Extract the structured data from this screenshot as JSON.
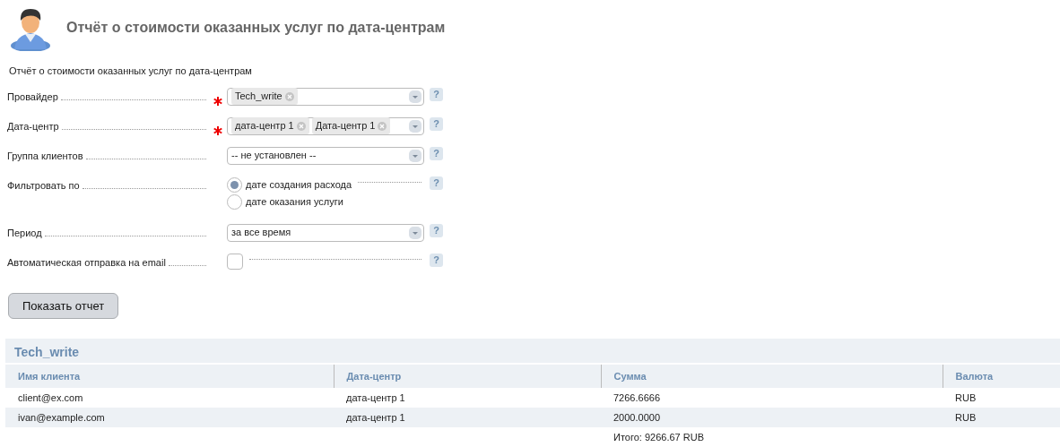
{
  "page_title": "Отчёт о стоимости оказанных услуг по дата-центрам",
  "form_title": "Отчёт о стоимости оказанных услуг по дата-центрам",
  "fields": [
    {
      "kind": "tags",
      "label": "Провайдер",
      "required": true,
      "tags": [
        "Tech_write"
      ],
      "help": "?"
    },
    {
      "kind": "tags",
      "label": "Дата-центр",
      "required": true,
      "tags": [
        "дата-центр 1",
        "Дата-центр 1"
      ],
      "help": "?"
    },
    {
      "kind": "select",
      "label": "Группа клиентов",
      "required": false,
      "value": "-- не установлен --",
      "help": "?"
    },
    {
      "kind": "radio",
      "label": "Фильтровать по",
      "required": false,
      "options": [
        {
          "label": "дате создания расхода",
          "selected": true
        },
        {
          "label": "дате оказания услуги",
          "selected": false
        }
      ],
      "help": "?"
    },
    {
      "kind": "select",
      "label": "Период",
      "required": false,
      "value": "за все время",
      "help": "?"
    },
    {
      "kind": "checkbox",
      "label": "Автоматическая отправка на email",
      "required": false,
      "checked": false,
      "help": "?"
    }
  ],
  "submit_button": "Показать отчет",
  "report": {
    "title": "Tech_write",
    "columns": [
      "Имя клиента",
      "Дата-центр",
      "Сумма",
      "Валюта"
    ],
    "rows": [
      [
        "client@ex.com",
        "дата-центр 1",
        "7266.6666",
        "RUB"
      ],
      [
        "ivan@example.com",
        "дата-центр 1",
        "2000.0000",
        "RUB"
      ]
    ],
    "total": "Итого: 9266.67 RUB"
  }
}
